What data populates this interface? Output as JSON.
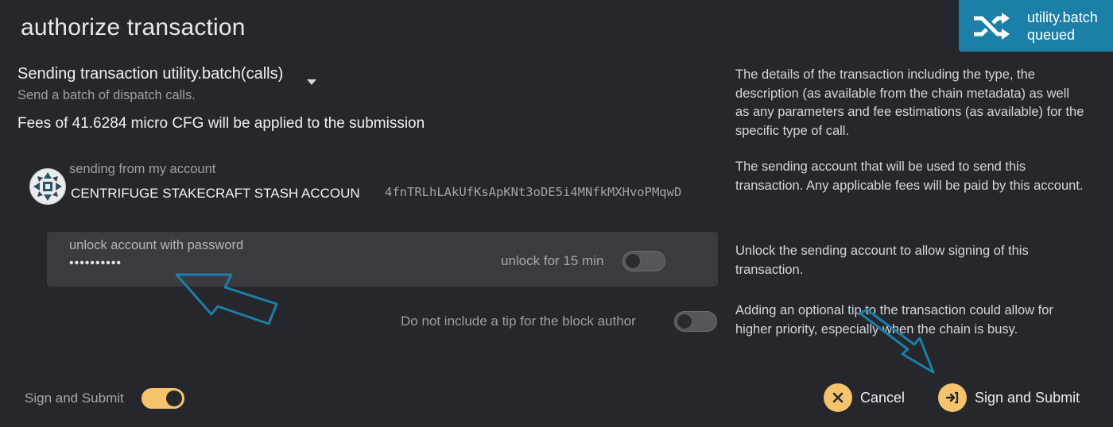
{
  "modal": {
    "title": "authorize transaction"
  },
  "notification": {
    "icon": "shuffle-icon",
    "line1": "utility.batch",
    "line2": "queued",
    "color": "#1b7fa8"
  },
  "call": {
    "heading": "Sending transaction utility.batch(calls)",
    "description": "Send a batch of dispatch calls.",
    "fees": "Fees of 41.6284 micro CFG will be applied to the submission"
  },
  "help": {
    "details": "The details of the transaction including the type, the description (as available from the chain metadata) as well as any parameters and fee estimations (as available) for the specific type of call.",
    "account": "The sending account that will be used to send this transaction. Any applicable fees will be paid by this account.",
    "unlock": "Unlock the sending account to allow signing of this transaction.",
    "tip": "Adding an optional tip to the transaction could allow for higher priority, especially when the chain is busy."
  },
  "account": {
    "label": "sending from my account",
    "name": "CENTRIFUGE STAKECRAFT STASH ACCOUN",
    "address": "4fnTRLhLAkUfKsApKNt3oDE5i4MNfkMXHvoPMqwD"
  },
  "password": {
    "label": "unlock account with password",
    "value": "••••••••••",
    "unlock_toggle_label": "unlock for 15 min",
    "unlock_toggle_on": false
  },
  "tip": {
    "toggle_label": "Do not include a tip for the block author",
    "toggle_on": false
  },
  "footer": {
    "mode_label": "Sign and Submit",
    "mode_toggle_on": true,
    "cancel_label": "Cancel",
    "submit_label": "Sign and Submit"
  },
  "colors": {
    "accent": "#f5c36c",
    "background": "#26272c",
    "annotation_arrow": "#1b7fa8"
  }
}
